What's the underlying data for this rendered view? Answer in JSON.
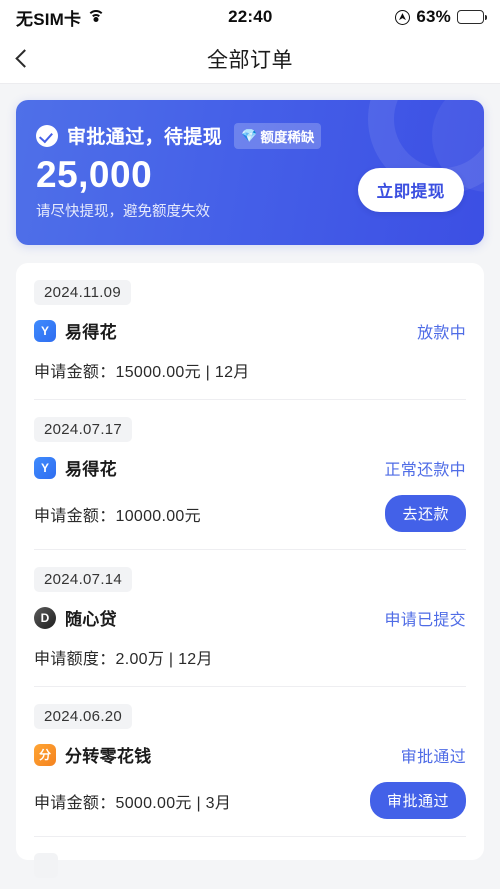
{
  "status_bar": {
    "carrier": "无SIM卡",
    "wifi_icon": "wifi-icon",
    "time": "22:40",
    "location_icon": "location-arrow-icon",
    "battery_percent": "63%",
    "battery_level": 63,
    "battery_icon": "battery-icon"
  },
  "nav": {
    "back_icon": "chevron-left-icon",
    "title": "全部订单"
  },
  "banner": {
    "check_icon": "check-circle-icon",
    "title": "审批通过，待提现",
    "badge_icon": "gem-icon",
    "badge_glyph": "💎",
    "badge_label": "额度稀缺",
    "amount": "25,000",
    "subtitle": "请尽快提现，避免额度失效",
    "cta_label": "立即提现",
    "gradient_start": "#4f70e8",
    "gradient_end": "#3c4fe4",
    "cta_text_color": "#3b4fe0"
  },
  "orders": [
    {
      "date": "2024.11.09",
      "icon_name": "yidehua-app-icon",
      "icon_glyph": "Y",
      "icon_class": "ico-ydh",
      "app_name": "易得花",
      "status": "放款中",
      "status_color": "#4f6ce6",
      "meta": "申请金额：15000.00元  |  12月",
      "button_label": ""
    },
    {
      "date": "2024.07.17",
      "icon_name": "yidehua-app-icon",
      "icon_glyph": "Y",
      "icon_class": "ico-ydh",
      "app_name": "易得花",
      "status": "正常还款中",
      "status_color": "#4f6ce6",
      "meta": "申请金额：10000.00元",
      "button_label": "去还款"
    },
    {
      "date": "2024.07.14",
      "icon_name": "suixindai-app-icon",
      "icon_glyph": "D",
      "icon_class": "ico-sxd",
      "app_name": "随心贷",
      "status": "申请已提交",
      "status_color": "#4f6ce6",
      "meta": "申请额度：2.00万  |  12月",
      "button_label": ""
    },
    {
      "date": "2024.06.20",
      "icon_name": "fenzhuanlinghuaqian-app-icon",
      "icon_glyph": "分",
      "icon_class": "ico-fzl",
      "app_name": "分转零花钱",
      "status": "审批通过",
      "status_color": "#4f6ce6",
      "meta": "申请金额：5000.00元  |  3月",
      "button_label": "审批通过"
    }
  ],
  "theme": {
    "page_background": "#f4f5f7",
    "card_background": "#ffffff",
    "primary_blue": "#4361e8",
    "chip_background": "#f2f3f5"
  }
}
